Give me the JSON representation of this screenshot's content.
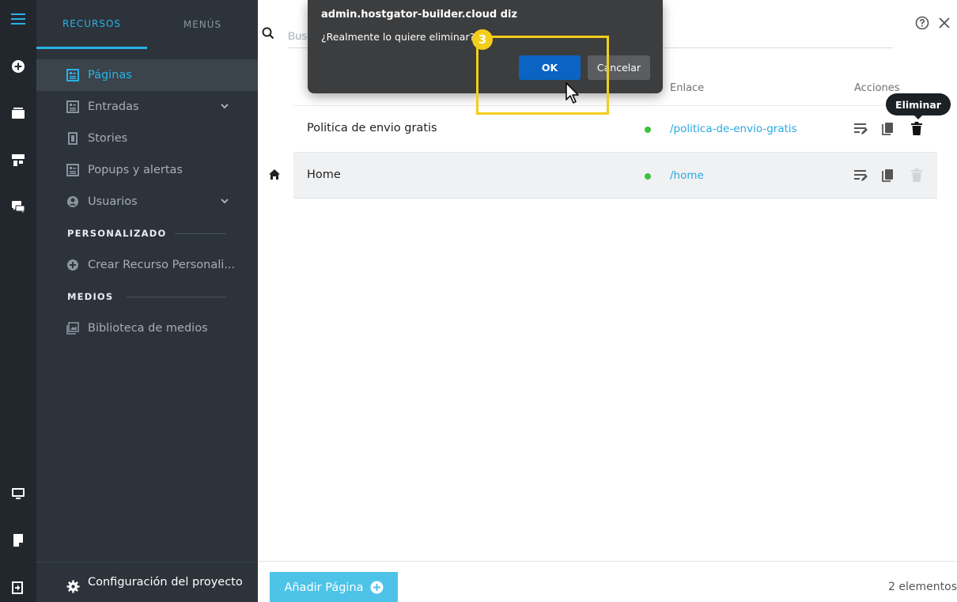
{
  "rail": {
    "icons": [
      "menu-icon",
      "add-circle-icon",
      "layers-icon",
      "widgets-icon",
      "chat-icon",
      "desktop-icon",
      "page-icon",
      "exit-icon"
    ]
  },
  "sidebar": {
    "tabs": [
      {
        "label": "RECURSOS"
      },
      {
        "label": "MENÚS"
      }
    ],
    "items": [
      {
        "label": "Páginas"
      },
      {
        "label": "Entradas"
      },
      {
        "label": "Stories"
      },
      {
        "label": "Popups y alertas"
      },
      {
        "label": "Usuarios"
      }
    ],
    "section_custom": "PERSONALIZADO",
    "create_custom": "Crear Recurso Personali...",
    "section_media": "MEDIOS",
    "media_library": "Biblioteca de medios",
    "config": "Configuración del proyecto"
  },
  "main": {
    "search_placeholder": "Buscar",
    "columns": {
      "link": "Enlace",
      "actions": "Acciones"
    },
    "rows": [
      {
        "title": "Politica de envio gratis",
        "link": "/politica-de-envio-gratis"
      },
      {
        "title": "Home",
        "link": "/home"
      }
    ],
    "tooltip": "Eliminar",
    "add_button": "Añadir Página",
    "count": "2 elementos"
  },
  "dialog": {
    "title": "admin.hostgator-builder.cloud diz",
    "message": "¿Realmente lo quiere eliminar?",
    "ok": "OK",
    "cancel": "Cancelar"
  },
  "annotation": {
    "step": "3"
  },
  "colors": {
    "accent": "#29b2e8",
    "ok_button": "#0b63c4",
    "highlight": "#f4cd1c",
    "status_published": "#3cc23b"
  }
}
